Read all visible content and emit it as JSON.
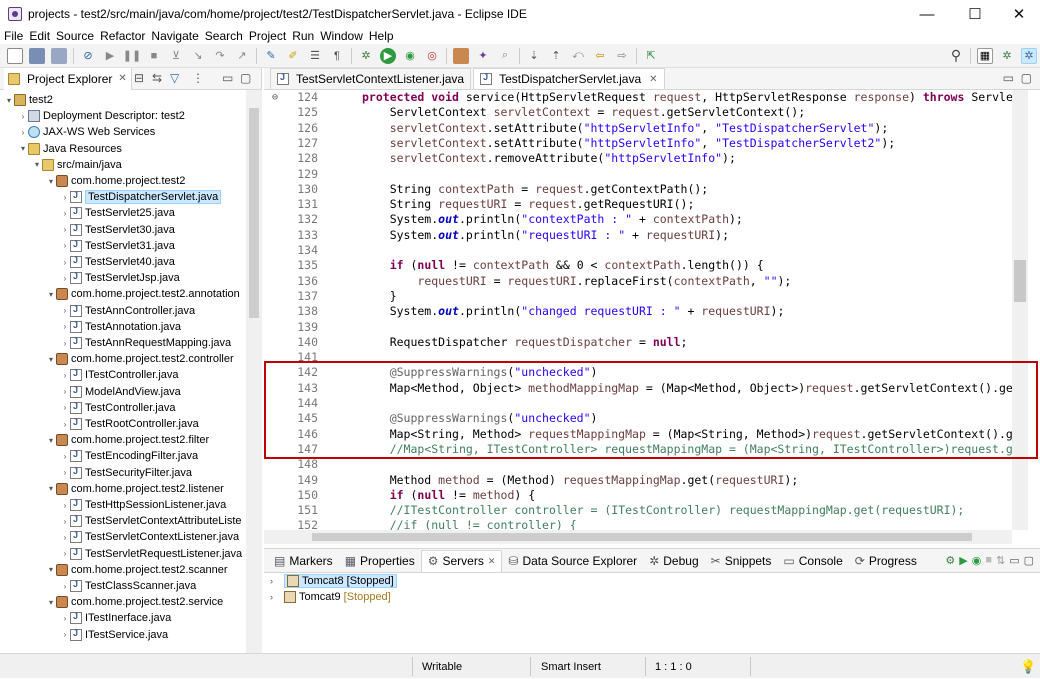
{
  "window": {
    "title": "projects - test2/src/main/java/com/home/project/test2/TestDispatcherServlet.java - Eclipse IDE",
    "minimize": "—",
    "maximize": "☐",
    "close": "✕"
  },
  "menu": [
    "File",
    "Edit",
    "Source",
    "Refactor",
    "Navigate",
    "Search",
    "Project",
    "Run",
    "Window",
    "Help"
  ],
  "explorer": {
    "tab_label": "Project Explorer",
    "tree": [
      {
        "label": "test2",
        "icon": "project-icon",
        "arrow": "▾",
        "indent": 0
      },
      {
        "label": "Deployment Descriptor: test2",
        "icon": "deployment-descriptor-icon",
        "arrow": "›",
        "indent": 1
      },
      {
        "label": "JAX-WS Web Services",
        "icon": "web-services-icon",
        "arrow": "›",
        "indent": 1
      },
      {
        "label": "Java Resources",
        "icon": "java-resources-icon",
        "arrow": "▾",
        "indent": 1
      },
      {
        "label": "src/main/java",
        "icon": "source-folder-icon",
        "arrow": "▾",
        "indent": 2
      },
      {
        "label": "com.home.project.test2",
        "icon": "package-icon",
        "arrow": "▾",
        "indent": 3
      },
      {
        "label": "TestDispatcherServlet.java",
        "icon": "java-file-icon",
        "arrow": "›",
        "indent": 4,
        "selected": true
      },
      {
        "label": "TestServlet25.java",
        "icon": "java-file-icon",
        "arrow": "›",
        "indent": 4
      },
      {
        "label": "TestServlet30.java",
        "icon": "java-file-icon",
        "arrow": "›",
        "indent": 4
      },
      {
        "label": "TestServlet31.java",
        "icon": "java-file-icon",
        "arrow": "›",
        "indent": 4
      },
      {
        "label": "TestServlet40.java",
        "icon": "java-file-icon",
        "arrow": "›",
        "indent": 4
      },
      {
        "label": "TestServletJsp.java",
        "icon": "java-file-icon",
        "arrow": "›",
        "indent": 4
      },
      {
        "label": "com.home.project.test2.annotation",
        "icon": "package-icon",
        "arrow": "▾",
        "indent": 3
      },
      {
        "label": "TestAnnController.java",
        "icon": "java-file-icon",
        "arrow": "›",
        "indent": 4
      },
      {
        "label": "TestAnnotation.java",
        "icon": "java-file-icon",
        "arrow": "›",
        "indent": 4
      },
      {
        "label": "TestAnnRequestMapping.java",
        "icon": "java-file-icon",
        "arrow": "›",
        "indent": 4
      },
      {
        "label": "com.home.project.test2.controller",
        "icon": "package-icon",
        "arrow": "▾",
        "indent": 3
      },
      {
        "label": "ITestController.java",
        "icon": "java-file-icon",
        "arrow": "›",
        "indent": 4
      },
      {
        "label": "ModelAndView.java",
        "icon": "java-file-icon",
        "arrow": "›",
        "indent": 4
      },
      {
        "label": "TestController.java",
        "icon": "java-file-icon",
        "arrow": "›",
        "indent": 4
      },
      {
        "label": "TestRootController.java",
        "icon": "java-file-icon",
        "arrow": "›",
        "indent": 4
      },
      {
        "label": "com.home.project.test2.filter",
        "icon": "package-icon",
        "arrow": "▾",
        "indent": 3
      },
      {
        "label": "TestEncodingFilter.java",
        "icon": "java-file-icon",
        "arrow": "›",
        "indent": 4
      },
      {
        "label": "TestSecurityFilter.java",
        "icon": "java-file-icon",
        "arrow": "›",
        "indent": 4
      },
      {
        "label": "com.home.project.test2.listener",
        "icon": "package-icon",
        "arrow": "▾",
        "indent": 3
      },
      {
        "label": "TestHttpSessionListener.java",
        "icon": "java-file-icon",
        "arrow": "›",
        "indent": 4
      },
      {
        "label": "TestServletContextAttributeListe",
        "icon": "java-file-icon",
        "arrow": "›",
        "indent": 4
      },
      {
        "label": "TestServletContextListener.java",
        "icon": "java-file-icon",
        "arrow": "›",
        "indent": 4
      },
      {
        "label": "TestServletRequestListener.java",
        "icon": "java-file-icon",
        "arrow": "›",
        "indent": 4
      },
      {
        "label": "com.home.project.test2.scanner",
        "icon": "package-icon",
        "arrow": "▾",
        "indent": 3
      },
      {
        "label": "TestClassScanner.java",
        "icon": "java-file-icon",
        "arrow": "›",
        "indent": 4
      },
      {
        "label": "com.home.project.test2.service",
        "icon": "package-icon",
        "arrow": "▾",
        "indent": 3
      },
      {
        "label": "ITestInerface.java",
        "icon": "java-file-icon",
        "arrow": "›",
        "indent": 4
      },
      {
        "label": "ITestService.java",
        "icon": "java-file-icon",
        "arrow": "›",
        "indent": 4
      }
    ]
  },
  "editor": {
    "tabs": [
      {
        "label": "TestServletContextListener.java",
        "active": false
      },
      {
        "label": "TestDispatcherServlet.java",
        "active": true
      }
    ],
    "lines": [
      {
        "n": "124",
        "marker": "⊖",
        "html": "<span class='k'>protected void</span> service(HttpServletRequest <span class='v'>request</span>, HttpServletResponse <span class='v'>response</span>) <span class='k'>throws</span> ServletExcept"
      },
      {
        "n": "125",
        "html": "    ServletContext <span class='v'>servletContext</span> = <span class='v'>request</span>.getServletContext();"
      },
      {
        "n": "126",
        "html": "    <span class='v'>servletContext</span>.setAttribute(<span class='s'>\"httpServletInfo\"</span>, <span class='s'>\"TestDispatcherServlet\"</span>);"
      },
      {
        "n": "127",
        "html": "    <span class='v'>servletContext</span>.setAttribute(<span class='s'>\"httpServletInfo\"</span>, <span class='s'>\"TestDispatcherServlet2\"</span>);"
      },
      {
        "n": "128",
        "html": "    <span class='v'>servletContext</span>.removeAttribute(<span class='s'>\"httpServletInfo\"</span>);"
      },
      {
        "n": "129",
        "html": ""
      },
      {
        "n": "130",
        "html": "    String <span class='v'>contextPath</span> = <span class='v'>request</span>.getContextPath();"
      },
      {
        "n": "131",
        "html": "    String <span class='v'>requestURI</span> = <span class='v'>request</span>.getRequestURI();"
      },
      {
        "n": "132",
        "html": "    System.<span class='so'>out</span>.println(<span class='s'>\"contextPath : \"</span> + <span class='v'>contextPath</span>);"
      },
      {
        "n": "133",
        "html": "    System.<span class='so'>out</span>.println(<span class='s'>\"requestURI : \"</span> + <span class='v'>requestURI</span>);"
      },
      {
        "n": "134",
        "html": ""
      },
      {
        "n": "135",
        "html": "    <span class='k'>if</span> (<span class='k'>null</span> != <span class='v'>contextPath</span> &amp;&amp; 0 &lt; <span class='v'>contextPath</span>.length()) {"
      },
      {
        "n": "136",
        "html": "        <span class='v'>requestURI</span> = <span class='v'>requestURI</span>.replaceFirst(<span class='v'>contextPath</span>, <span class='s'>\"\"</span>);"
      },
      {
        "n": "137",
        "html": "    }"
      },
      {
        "n": "138",
        "html": "    System.<span class='so'>out</span>.println(<span class='s'>\"changed requestURI : \"</span> + <span class='v'>requestURI</span>);"
      },
      {
        "n": "139",
        "html": ""
      },
      {
        "n": "140",
        "html": "    RequestDispatcher <span class='v'>requestDispatcher</span> = <span class='k'>null</span>;"
      },
      {
        "n": "141",
        "html": ""
      },
      {
        "n": "142",
        "html": "    <span class='a'>@SuppressWarnings</span>(<span class='s'>\"unchecked\"</span>)"
      },
      {
        "n": "143",
        "html": "    Map&lt;Method, Object&gt; <span class='v'>methodMappingMap</span> = (Map&lt;Method, Object&gt;)<span class='v'>request</span>.getServletContext().getAttrib"
      },
      {
        "n": "144",
        "html": ""
      },
      {
        "n": "145",
        "html": "    <span class='a'>@SuppressWarnings</span>(<span class='s'>\"unchecked\"</span>)"
      },
      {
        "n": "146",
        "html": "    Map&lt;String, Method&gt; <span class='v'>requestMappingMap</span> = (Map&lt;String, Method&gt;)<span class='v'>request</span>.getServletContext().getAttri"
      },
      {
        "n": "147",
        "html": "    <span class='c'>//Map&lt;String, ITestController&gt; requestMappingMap = (Map&lt;String, ITestController&gt;)request.getServl</span>"
      },
      {
        "n": "148",
        "html": ""
      },
      {
        "n": "149",
        "html": "    Method <span class='v'>method</span> = (Method) <span class='v'>requestMappingMap</span>.get(<span class='v'>requestURI</span>);"
      },
      {
        "n": "150",
        "html": "    <span class='k'>if</span> (<span class='k'>null</span> != <span class='v'>method</span>) {"
      },
      {
        "n": "151",
        "html": "    <span class='c'>//ITestController controller = (ITestController) requestMappingMap.get(requestURI);</span>"
      },
      {
        "n": "152",
        "html": "    <span class='c'>//if (null != controller) {</span>"
      }
    ]
  },
  "bottom": {
    "tabs": [
      {
        "label": "Markers",
        "icon": "markers-icon"
      },
      {
        "label": "Properties",
        "icon": "properties-icon"
      },
      {
        "label": "Servers",
        "icon": "servers-icon",
        "active": true
      },
      {
        "label": "Data Source Explorer",
        "icon": "data-source-icon"
      },
      {
        "label": "Debug",
        "icon": "debug-icon"
      },
      {
        "label": "Snippets",
        "icon": "snippets-icon"
      },
      {
        "label": "Console",
        "icon": "console-icon"
      },
      {
        "label": "Progress",
        "icon": "progress-icon"
      }
    ],
    "servers": [
      {
        "name": "Tomcat8",
        "state": "[Stopped]",
        "selected": true
      },
      {
        "name": "Tomcat9",
        "state": "[Stopped]",
        "selected": false
      }
    ]
  },
  "status": {
    "writable": "Writable",
    "insert_mode": "Smart Insert",
    "position": "1 : 1 : 0"
  }
}
